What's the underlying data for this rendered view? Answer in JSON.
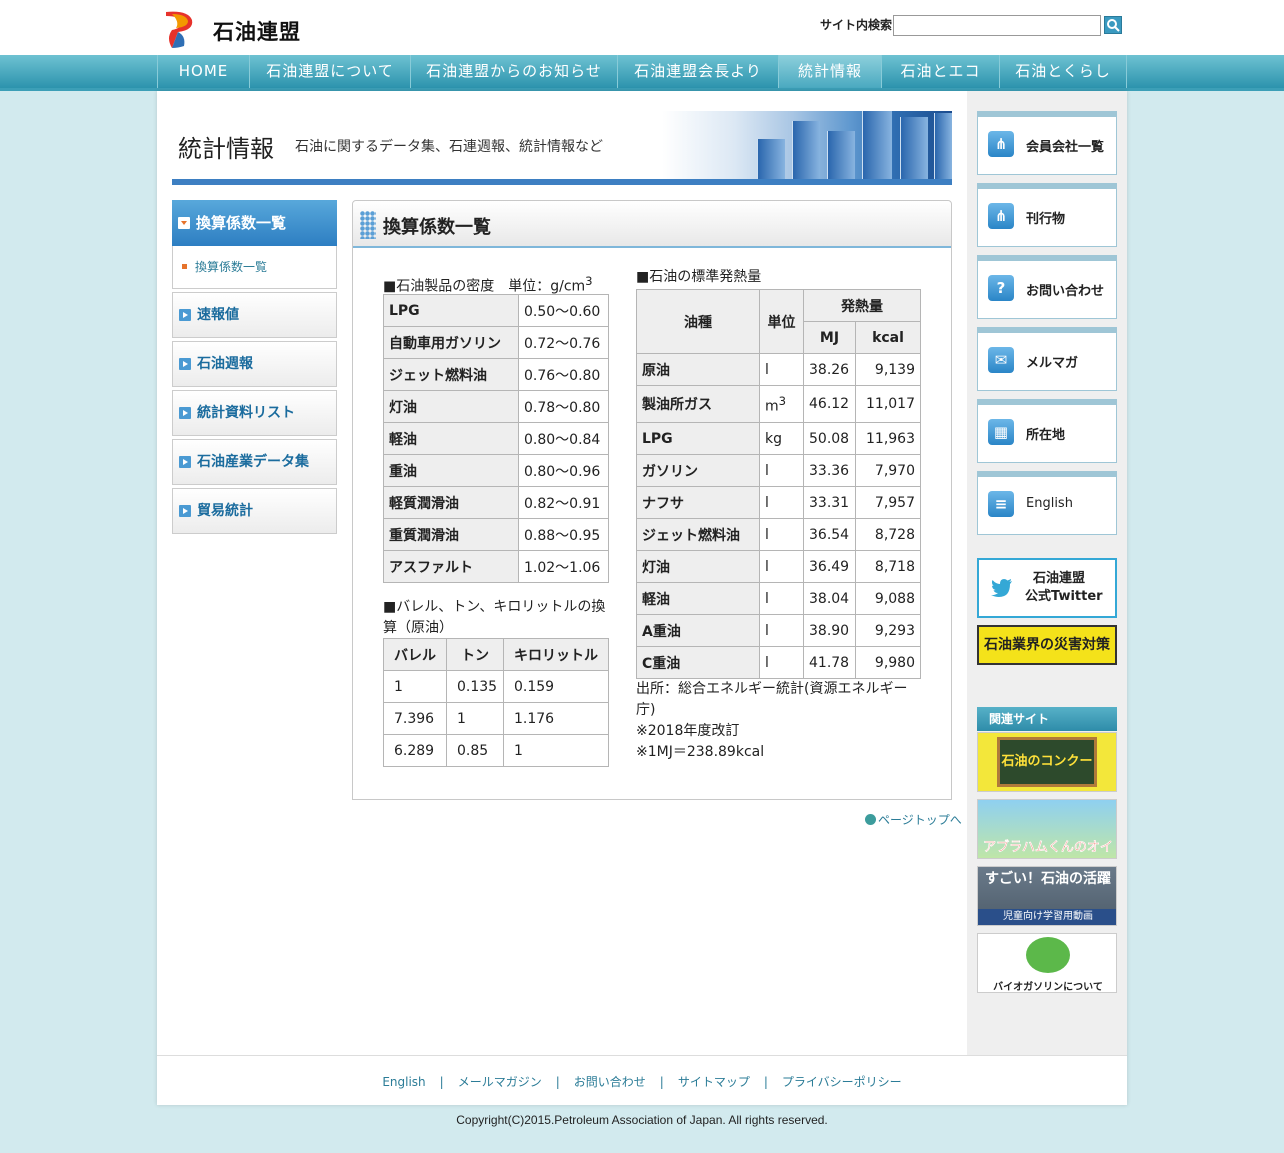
{
  "header": {
    "logo_text": "石油連盟",
    "search_label": "サイト内検索",
    "search_value": "",
    "search_button_icon": "search-icon"
  },
  "gnav": [
    "HOME",
    "石油連盟について",
    "石油連盟からのお知らせ",
    "石油連盟会長より",
    "統計情報",
    "石油とエコ",
    "石油とくらし"
  ],
  "banner": {
    "title": "統計情報",
    "subtitle": "石油に関するデータ集、石連週報、統計情報など"
  },
  "local_nav": {
    "current": "換算係数一覧",
    "current_sub": "換算係数一覧",
    "items": [
      "速報値",
      "石油週報",
      "統計資料リスト",
      "石油産業データ集",
      "貿易統計"
    ]
  },
  "content": {
    "title": "換算係数一覧",
    "density": {
      "caption": "■石油製品の密度　単位：g/cm",
      "caption_sup": "3",
      "rows": [
        [
          "LPG",
          "0.50～0.60"
        ],
        [
          "自動車用ガソリン",
          "0.72～0.76"
        ],
        [
          "ジェット燃料油",
          "0.76～0.80"
        ],
        [
          "灯油",
          "0.78～0.80"
        ],
        [
          "軽油",
          "0.80～0.84"
        ],
        [
          "重油",
          "0.80～0.96"
        ],
        [
          "軽質潤滑油",
          "0.82～0.91"
        ],
        [
          "重質潤滑油",
          "0.88～0.95"
        ],
        [
          "アスファルト",
          "1.02～1.06"
        ]
      ]
    },
    "barrel": {
      "caption": "■バレル、トン、キロリットルの換算（原油）",
      "headers": [
        "バレル",
        "トン",
        "キロリットル"
      ],
      "rows": [
        [
          "1",
          "0.135",
          "0.159"
        ],
        [
          "7.396",
          "1",
          "1.176"
        ],
        [
          "6.289",
          "0.85",
          "1"
        ]
      ]
    },
    "heat": {
      "caption": "■石油の標準発熱量",
      "headers": {
        "type": "油種",
        "unit": "単位",
        "group": "発熱量",
        "mj": "MJ",
        "kcal": "kcal"
      },
      "rows": [
        [
          "原油",
          "l",
          "38.26",
          "9,139"
        ],
        [
          "製油所ガス",
          "m",
          "46.12",
          "11,017"
        ],
        [
          "LPG",
          "kg",
          "50.08",
          "11,963"
        ],
        [
          "ガソリン",
          "l",
          "33.36",
          "7,970"
        ],
        [
          "ナフサ",
          "l",
          "33.31",
          "7,957"
        ],
        [
          "ジェット燃料油",
          "l",
          "36.54",
          "8,728"
        ],
        [
          "灯油",
          "l",
          "36.49",
          "8,718"
        ],
        [
          "軽油",
          "l",
          "38.04",
          "9,088"
        ],
        [
          "A重油",
          "l",
          "38.90",
          "9,293"
        ],
        [
          "C重油",
          "l",
          "41.78",
          "9,980"
        ]
      ],
      "gas_unit_sup": "3",
      "source": "出所：総合エネルギー統計(資源エネルギー庁)",
      "note1": "※2018年度改訂",
      "note2": "※1MJ＝238.89kcal"
    }
  },
  "pagetop": "ページトップへ",
  "right": {
    "boxes": [
      {
        "label": "会員会社一覧",
        "icon": "share-icon"
      },
      {
        "label": "刊行物",
        "icon": "share-icon"
      },
      {
        "label": "お問い合わせ",
        "icon": "question-icon"
      },
      {
        "label": "メルマガ",
        "icon": "mail-icon"
      },
      {
        "label": "所在地",
        "icon": "building-icon"
      },
      {
        "label": "English",
        "icon": "document-icon"
      }
    ],
    "twitter_line1": "石油連盟",
    "twitter_line2": "公式Twitter",
    "disaster": "石油業界の災害対策",
    "related_head": "関連サイト",
    "related": [
      "石油のコンクール",
      "アブラハムくんのオイルワールド",
      "すごい！石油の活躍",
      "児童向け学習用動画",
      "バイオガソリンについて"
    ]
  },
  "footer": {
    "links": [
      "English",
      "メールマガジン",
      "お問い合わせ",
      "サイトマップ",
      "プライバシーポリシー"
    ],
    "copyright": "Copyright(C)2015.Petroleum Association of Japan. All rights reserved."
  },
  "colors": {
    "nav": "#2c93ad",
    "accent": "#3d7fc2",
    "background": "#d2eaee",
    "link": "#2b7c97"
  }
}
